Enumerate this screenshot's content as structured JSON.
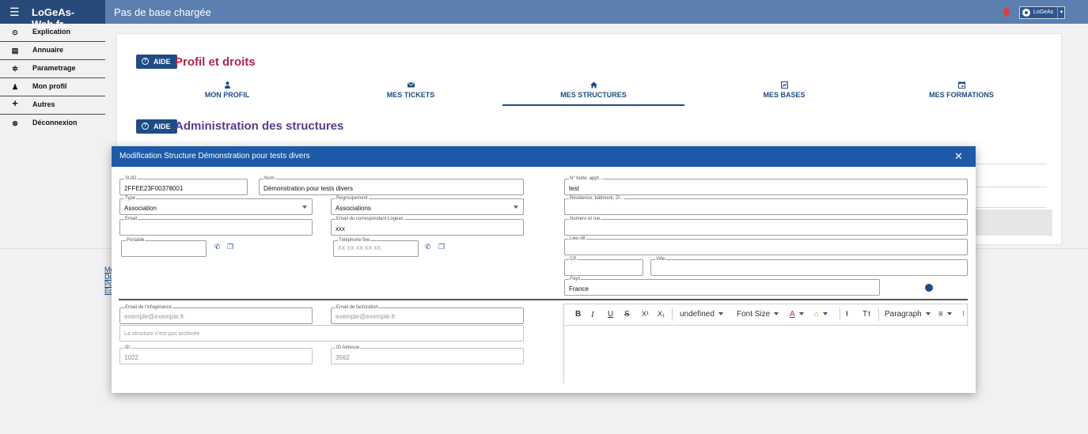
{
  "topbar": {
    "brand": "LoGeAs-Web.fr",
    "page_title": "Pas de base chargée",
    "user_label": "LoGeAs",
    "icons": {
      "menu": "menu-icon",
      "bell": "bell-icon",
      "user": "user-circle-icon"
    },
    "color": "#5b7fae",
    "brand_color": "#284a78"
  },
  "sidebar": {
    "items": [
      {
        "label": "Explication",
        "icon": "help-circle-icon"
      },
      {
        "label": "Annuaire",
        "icon": "directory-icon"
      },
      {
        "label": "Parametrage",
        "icon": "gear-icon"
      },
      {
        "label": "Mon profil",
        "icon": "person-icon"
      },
      {
        "label": "Autres",
        "icon": "plus-icon"
      },
      {
        "label": "Déconnexion",
        "icon": "logout-icon"
      }
    ]
  },
  "main": {
    "aide_label": "AIDE",
    "section1_title": "Profil et droits",
    "section2_title": "Administration des structures",
    "tabs": [
      {
        "label": "MON PROFIL",
        "icon": "person-icon"
      },
      {
        "label": "MES TICKETS",
        "icon": "mail-icon"
      },
      {
        "label": "MES STRUCTURES",
        "icon": "home-icon",
        "active": true
      },
      {
        "label": "MES BASES",
        "icon": "database-icon"
      },
      {
        "label": "MES FORMATIONS",
        "icon": "calendar-icon"
      }
    ],
    "footer_links": [
      "Me",
      "Do",
      "Po",
      "Ec"
    ]
  },
  "modal": {
    "title": "Modification Structure Démonstration pour tests divers",
    "fields": {
      "suid": {
        "label": "SUID",
        "value": "2FFEE23F00378001"
      },
      "nom": {
        "label": "Nom",
        "value": "Démonstration pour tests divers"
      },
      "type": {
        "label": "Type",
        "value": "Association"
      },
      "regroupement": {
        "label": "Regroupement",
        "value": "Associations"
      },
      "email": {
        "label": "Email",
        "value": ""
      },
      "email_correspondant": {
        "label": "Email du correspondant Logeas",
        "value": "xxx"
      },
      "portable": {
        "label": "Portable",
        "value": ""
      },
      "telephone_fixe": {
        "label": "Téléphone fixe",
        "value": "XX XX XX XX XX"
      },
      "boite": {
        "label": "N° boite, appt...",
        "value": "test"
      },
      "residence": {
        "label": "Résidence, bâtiment, ZI...",
        "value": ""
      },
      "numero_rue": {
        "label": "Numéro et rue",
        "value": ""
      },
      "lieu_dit": {
        "label": "Lieu-dit",
        "value": ""
      },
      "cp": {
        "label": "CP",
        "value": ""
      },
      "ville": {
        "label": "Ville",
        "value": ""
      },
      "pays": {
        "label": "Pays",
        "value": "France"
      },
      "email_infogerance": {
        "label": "Email de l'infogérance",
        "placeholder": "exemple@exemple.fr"
      },
      "email_facturation": {
        "label": "Email de facturation",
        "placeholder": "exemple@exemple.fr"
      },
      "archive_status": {
        "value": "La structure n'est pas archivée"
      },
      "id": {
        "label": "ID",
        "value": "1022"
      },
      "id_adresse": {
        "label": "ID Adresse",
        "value": "3562"
      }
    },
    "editor": {
      "font_family": "undefined",
      "font_size": "Font Size",
      "paragraph": "Paragraph",
      "buttons": {
        "bold": "B",
        "italic": "I",
        "underline": "U",
        "strike": "S",
        "superscript": "X¹",
        "subscript": "X₁"
      }
    }
  }
}
